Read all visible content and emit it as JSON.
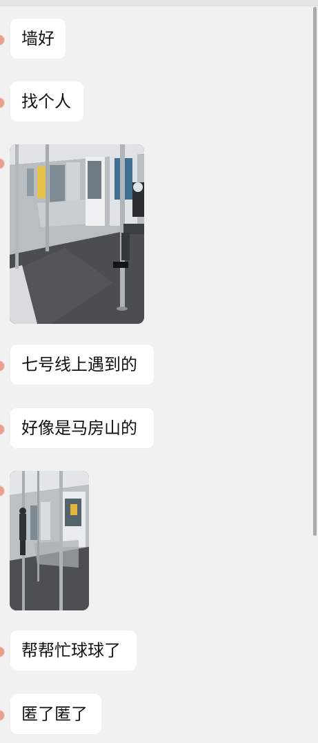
{
  "messages": [
    {
      "type": "text",
      "text": "墙好"
    },
    {
      "type": "text",
      "text": "找个人"
    },
    {
      "type": "image",
      "subject": "subway-car-interior-photo"
    },
    {
      "type": "text",
      "text": "七号线上遇到的"
    },
    {
      "type": "text",
      "text": "好像是马房山的"
    },
    {
      "type": "image",
      "subject": "subway-car-interior-photo"
    },
    {
      "type": "text",
      "text": "帮帮忙球球了"
    },
    {
      "type": "text",
      "text": "匿了匿了"
    }
  ],
  "colors": {
    "background": "#f1f1f1",
    "bubble": "#ffffff",
    "text": "#111111",
    "avatar": "#e7a08f",
    "scrollbar": "#a9a9a9"
  }
}
